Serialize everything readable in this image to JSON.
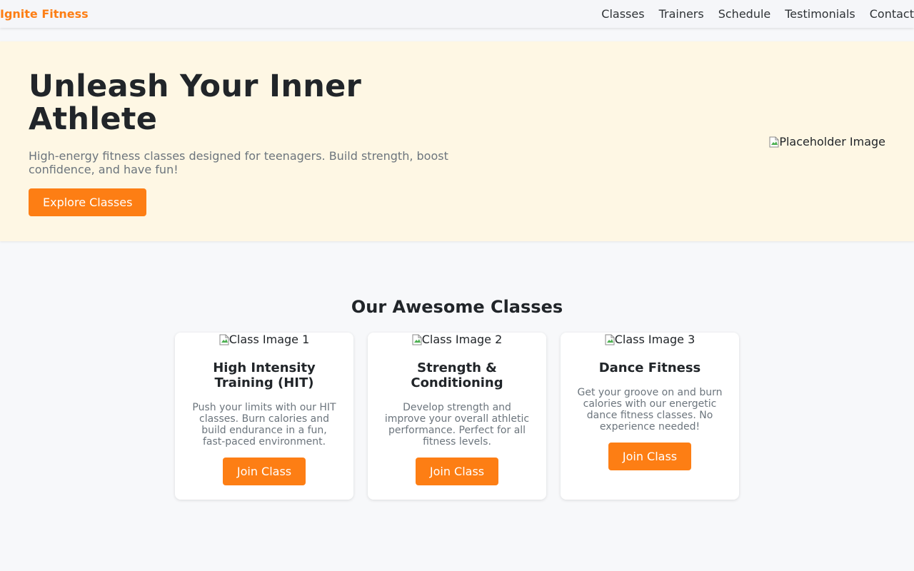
{
  "brand": "Ignite Fitness",
  "colors": {
    "accent": "#fd7e14",
    "hero_bg": "#fef7e4",
    "page_bg": "#f7f8fa"
  },
  "nav": {
    "links": [
      "Classes",
      "Trainers",
      "Schedule",
      "Testimonials",
      "Contact"
    ]
  },
  "hero": {
    "title": "Unleash Your Inner Athlete",
    "subtitle": "High-energy fitness classes designed for teenagers. Build strength, boost confidence, and have fun!",
    "button_label": "Explore Classes",
    "image_alt": "Placeholder Image"
  },
  "classes": {
    "section_title": "Our Awesome Classes",
    "cards": [
      {
        "image_alt": "Class Image 1",
        "title": "High Intensity Training (HIT)",
        "text": "Push your limits with our HIT classes. Burn calories and build endurance in a fun, fast-paced environment.",
        "button_label": "Join Class"
      },
      {
        "image_alt": "Class Image 2",
        "title": "Strength & Conditioning",
        "text": "Develop strength and improve your overall athletic performance. Perfect for all fitness levels.",
        "button_label": "Join Class"
      },
      {
        "image_alt": "Class Image 3",
        "title": "Dance Fitness",
        "text": "Get your groove on and burn calories with our energetic dance fitness classes. No experience needed!",
        "button_label": "Join Class"
      }
    ]
  }
}
